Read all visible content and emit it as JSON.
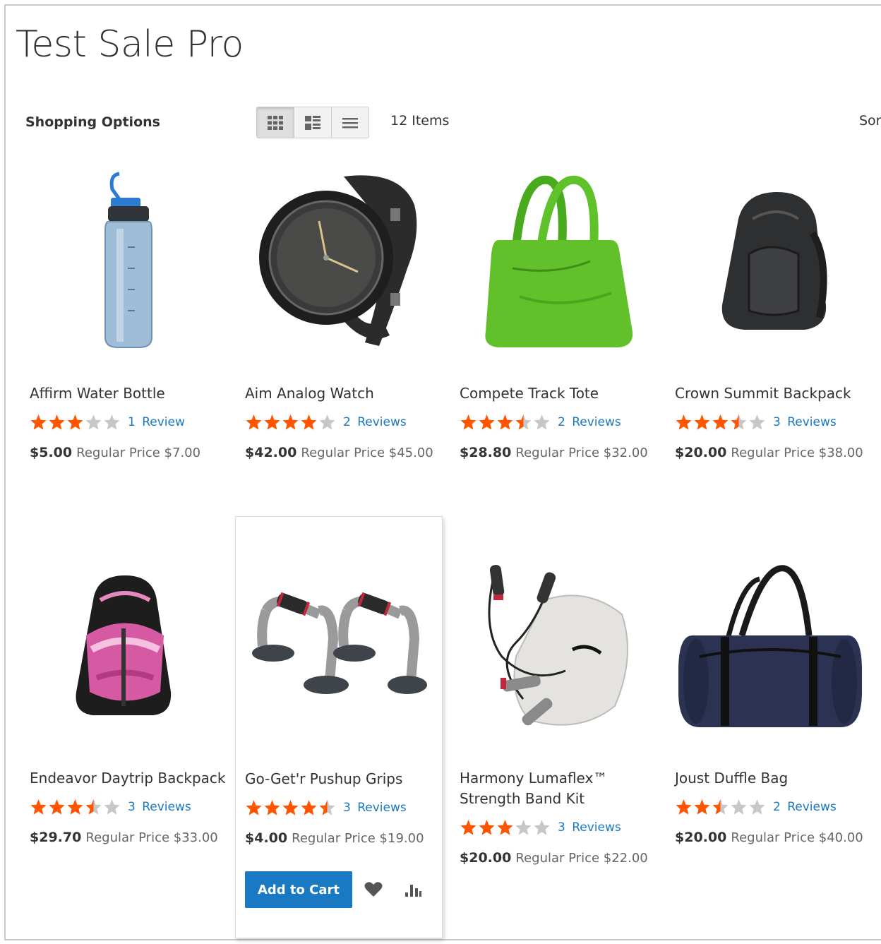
{
  "page": {
    "title": "Test Sale Pro"
  },
  "toolbar": {
    "shopping_options": "Shopping Options",
    "modes": [
      {
        "name": "grid-view",
        "icon": "grid-icon",
        "active": true
      },
      {
        "name": "grid-list-view",
        "icon": "grid-list-icon",
        "active": false
      },
      {
        "name": "list-view",
        "icon": "list-icon",
        "active": false
      }
    ],
    "amount": "12 Items",
    "sort_label": "Sor"
  },
  "colors": {
    "star_filled": "#ff5501",
    "star_empty": "#c7c7c7",
    "link": "#1979c3",
    "primary_button": "#1979c3"
  },
  "products": [
    {
      "name": "Affirm Water Bottle",
      "rating": 3,
      "reviews": "1 Review",
      "special_price": "$5.00",
      "old_price": "Regular Price $7.00",
      "icon": "water-bottle-image"
    },
    {
      "name": "Aim Analog Watch",
      "rating": 4,
      "reviews": "2 Reviews",
      "special_price": "$42.00",
      "old_price": "Regular Price $45.00",
      "icon": "watch-image"
    },
    {
      "name": "Compete Track Tote",
      "rating": 3.5,
      "reviews": "2 Reviews",
      "special_price": "$28.80",
      "old_price": "Regular Price $32.00",
      "icon": "tote-bag-image"
    },
    {
      "name": "Crown Summit Backpack",
      "rating": 3.5,
      "reviews": "3 Reviews",
      "special_price": "$20.00",
      "old_price": "Regular Price $38.00",
      "icon": "backpack-image"
    },
    {
      "name": "Endeavor Daytrip Backpack",
      "rating": 3.5,
      "reviews": "3 Reviews",
      "special_price": "$29.70",
      "old_price": "Regular Price $33.00",
      "icon": "pink-backpack-image"
    },
    {
      "name": "Go-Get'r Pushup Grips",
      "rating": 4.5,
      "reviews": "3 Reviews",
      "special_price": "$4.00",
      "old_price": "Regular Price $19.00",
      "icon": "pushup-grips-image"
    },
    {
      "name": "Harmony Lumaflex™ Strength Band Kit",
      "name_line1": "Harmony Lumaflex™",
      "name_line2": "Strength Band Kit",
      "rating": 3,
      "reviews": "3 Reviews",
      "special_price": "$20.00",
      "old_price": "Regular Price $22.00",
      "icon": "band-kit-image"
    },
    {
      "name": "Joust Duffle Bag",
      "rating": 2.5,
      "reviews": "2 Reviews",
      "special_price": "$20.00",
      "old_price": "Regular Price $40.00",
      "icon": "duffle-bag-image"
    }
  ],
  "hover_actions": {
    "add_to_cart": "Add to Cart",
    "wishlist_icon": "heart-icon",
    "compare_icon": "compare-icon"
  }
}
